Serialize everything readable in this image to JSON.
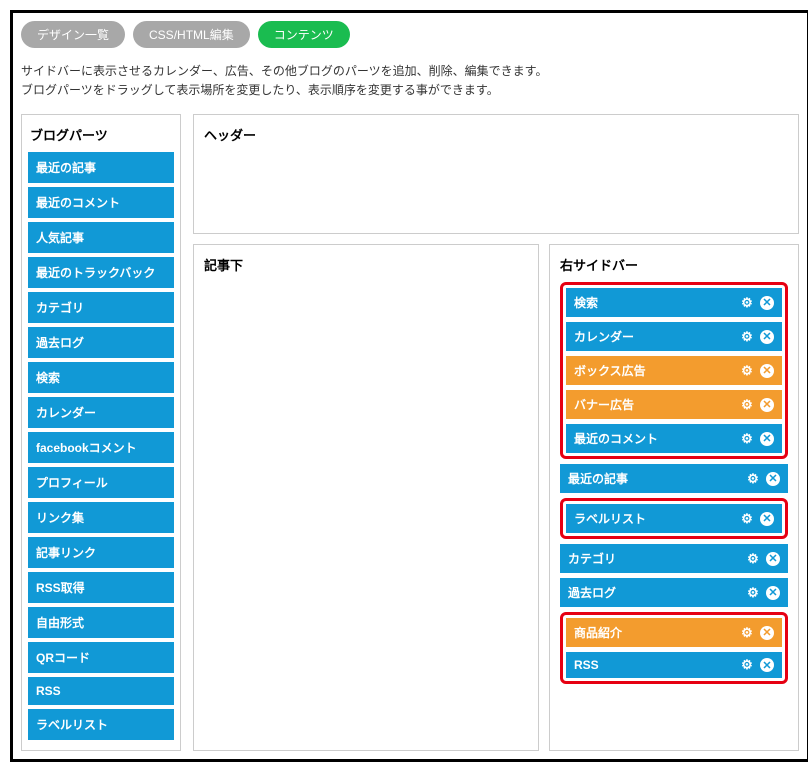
{
  "tabs": {
    "design": "デザイン一覧",
    "csshtml": "CSS/HTML編集",
    "contents": "コンテンツ"
  },
  "description": {
    "line1": "サイドバーに表示させるカレンダー、広告、その他ブログのパーツを追加、削除、編集できます。",
    "line2": "ブログパーツをドラッグして表示場所を変更したり、表示順序を変更する事ができます。"
  },
  "sidebar": {
    "title": "ブログパーツ",
    "items": [
      "最近の記事",
      "最近のコメント",
      "人気記事",
      "最近のトラックバック",
      "カテゴリ",
      "過去ログ",
      "検索",
      "カレンダー",
      "facebookコメント",
      "プロフィール",
      "リンク集",
      "記事リンク",
      "RSS取得",
      "自由形式",
      "QRコード",
      "RSS",
      "ラベルリスト"
    ]
  },
  "zones": {
    "header": "ヘッダー",
    "below_article": "記事下",
    "right_sidebar": "右サイドバー"
  },
  "placed": {
    "group1": [
      {
        "label": "検索",
        "color": "blue"
      },
      {
        "label": "カレンダー",
        "color": "blue"
      },
      {
        "label": "ボックス広告",
        "color": "orange"
      },
      {
        "label": "バナー広告",
        "color": "orange"
      },
      {
        "label": "最近のコメント",
        "color": "blue"
      }
    ],
    "single1": {
      "label": "最近の記事",
      "color": "blue"
    },
    "group2": [
      {
        "label": "ラベルリスト",
        "color": "blue"
      }
    ],
    "single2": {
      "label": "カテゴリ",
      "color": "blue"
    },
    "single3": {
      "label": "過去ログ",
      "color": "blue"
    },
    "group3": [
      {
        "label": "商品紹介",
        "color": "orange"
      },
      {
        "label": "RSS",
        "color": "blue"
      }
    ]
  }
}
